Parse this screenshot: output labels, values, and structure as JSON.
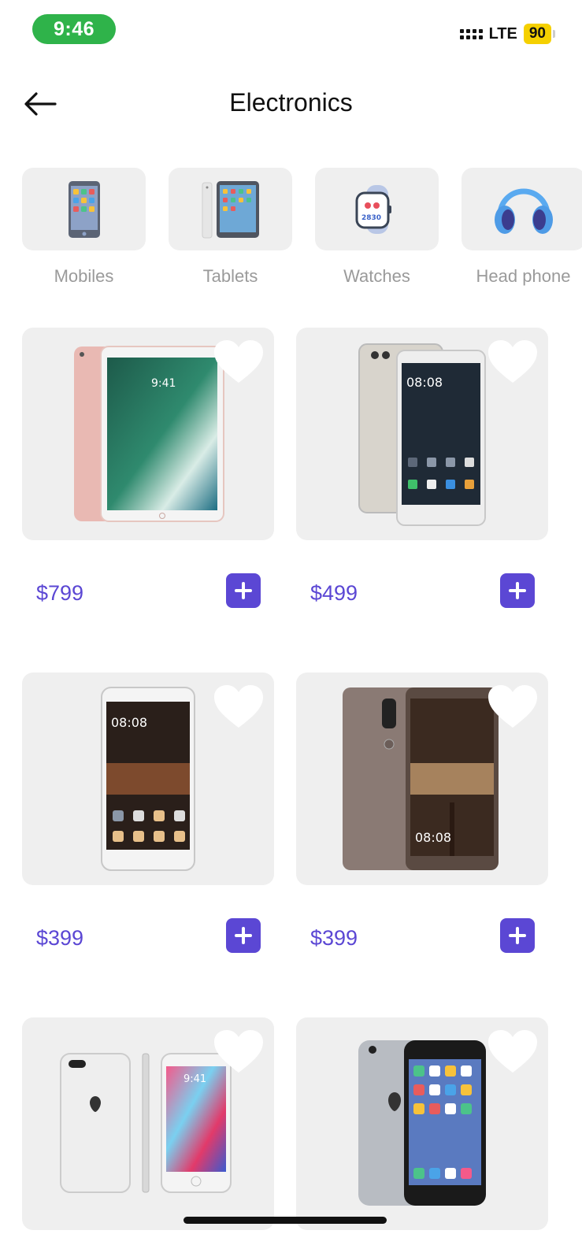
{
  "status_bar": {
    "time": "9:46",
    "network": "LTE",
    "battery": "90"
  },
  "header": {
    "title": "Electronics",
    "back_icon": "arrow-left-icon"
  },
  "categories": [
    {
      "label": "Mobiles",
      "icon": "mobile-phone-icon"
    },
    {
      "label": "Tablets",
      "icon": "tablet-icon"
    },
    {
      "label": "Watches",
      "icon": "smartwatch-icon"
    },
    {
      "label": "Head phone",
      "icon": "headphones-icon"
    }
  ],
  "products": [
    {
      "price": "$799",
      "image": "ipad-pro-rose-gold"
    },
    {
      "price": "$499",
      "image": "huawei-p9-silver"
    },
    {
      "price": "$399",
      "image": "huawei-y5-white"
    },
    {
      "price": "$399",
      "image": "huawei-mate-9-mocha"
    },
    {
      "price": "",
      "image": "iphone-8-silver"
    },
    {
      "price": "",
      "image": "iphone-6s-space-gray"
    }
  ],
  "colors": {
    "accent": "#5b47d4",
    "tile_bg": "#efefef",
    "muted_text": "#9a9a9a",
    "time_pill": "#2fb34a",
    "battery": "#f5d000"
  }
}
